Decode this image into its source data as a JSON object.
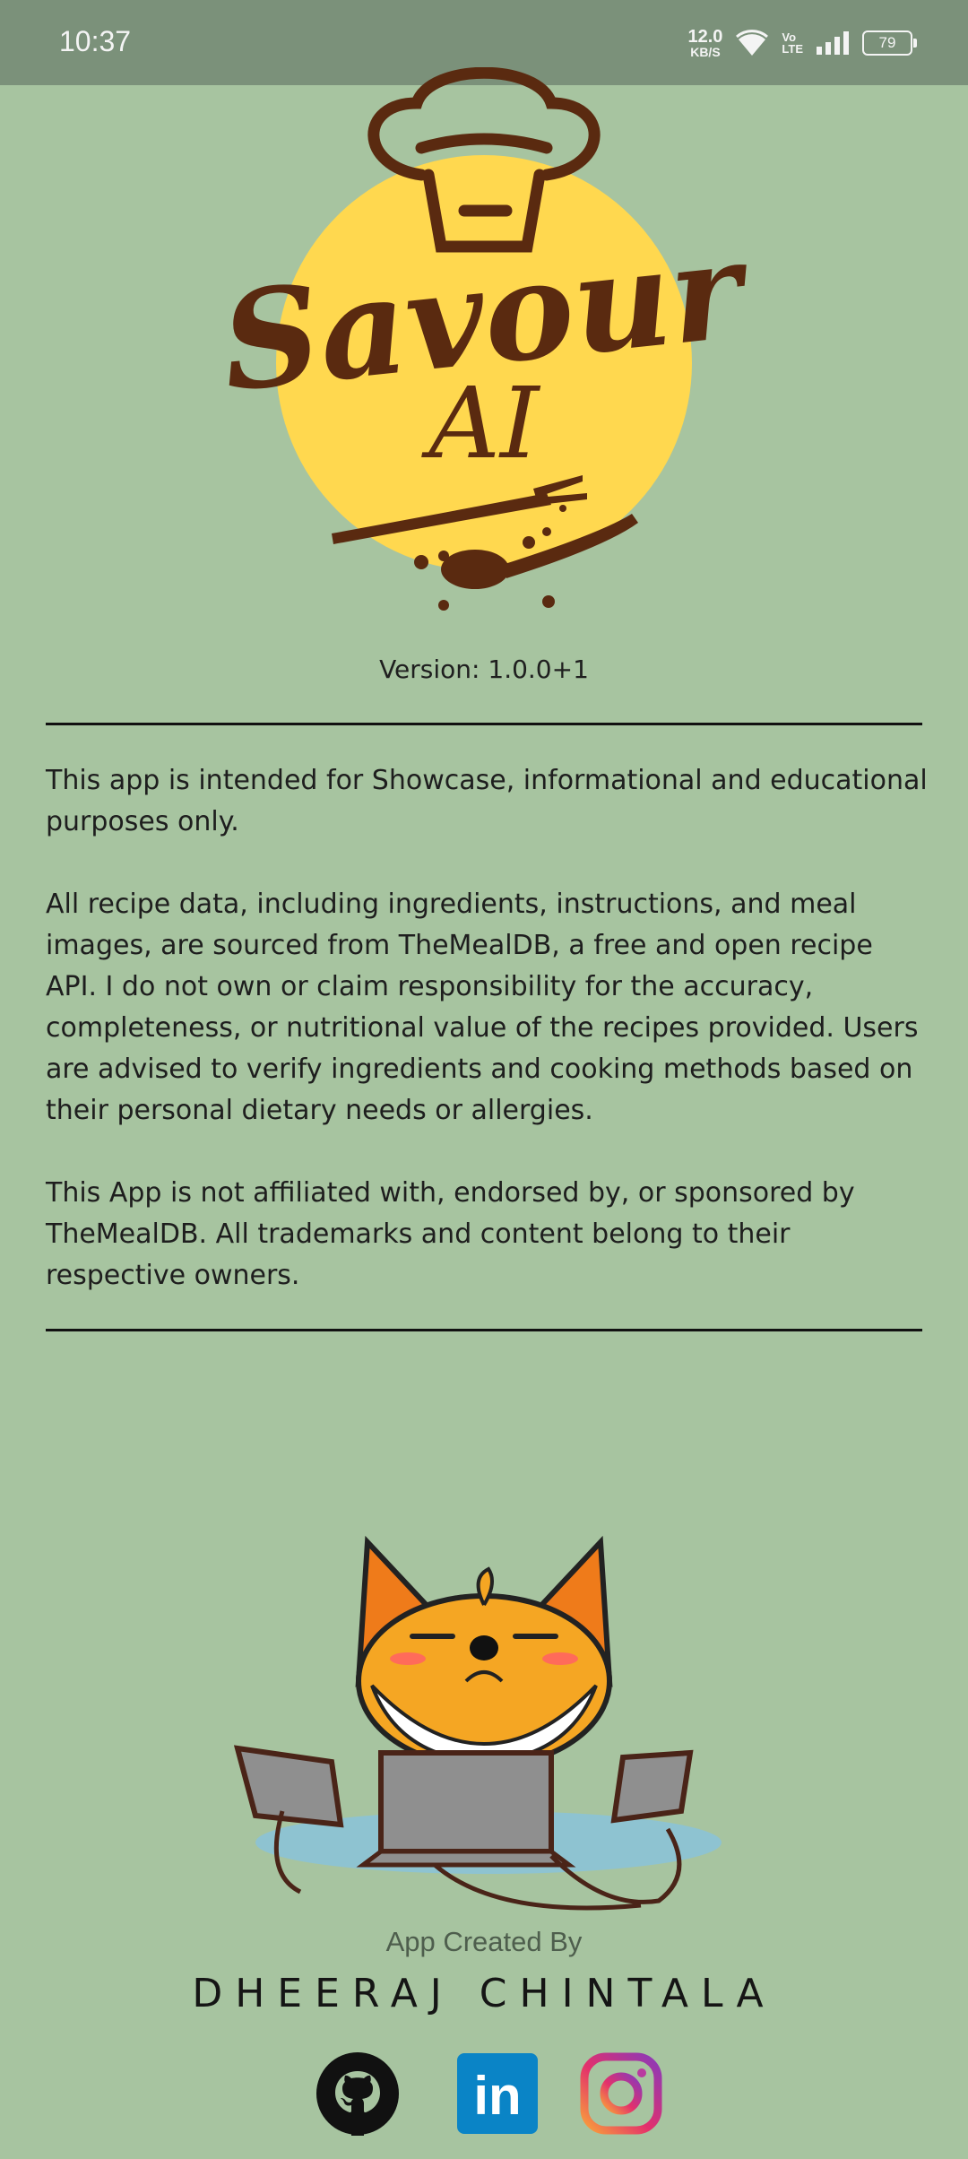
{
  "status_bar": {
    "time": "10:37",
    "net_speed_value": "12.0",
    "net_speed_unit": "KB/S",
    "volte_top": "Vo",
    "volte_bottom": "LTE",
    "battery": "79"
  },
  "logo": {
    "brand_word": "Savour",
    "brand_sub": "AI",
    "colors": {
      "sun": "#ffd84f",
      "brown": "#5a2a10"
    }
  },
  "version_text": "Version: 1.0.0+1",
  "disclaimer": {
    "p1": "This app is intended for Showcase, informational and educational purposes only.",
    "p2": "All recipe data, including ingredients, instructions, and meal images, are sourced from TheMealDB, a free and open recipe API. I do not own or claim responsibility for the accuracy, completeness, or nutritional value of the recipes provided. Users are advised to verify ingredients and cooking methods based on their personal dietary needs or allergies.",
    "p3": "This App is not affiliated with, endorsed by, or sponsored by TheMealDB. All trademarks and content belong to their respective owners."
  },
  "credits": {
    "created_by": "App Created By",
    "author": "DHEERAJ CHINTALA"
  },
  "social": {
    "icons": [
      "github-icon",
      "linkedin-icon",
      "instagram-icon"
    ],
    "linkedin_text": "in",
    "colors": {
      "linkedin": "#0a84c6",
      "github": "#111111"
    }
  }
}
